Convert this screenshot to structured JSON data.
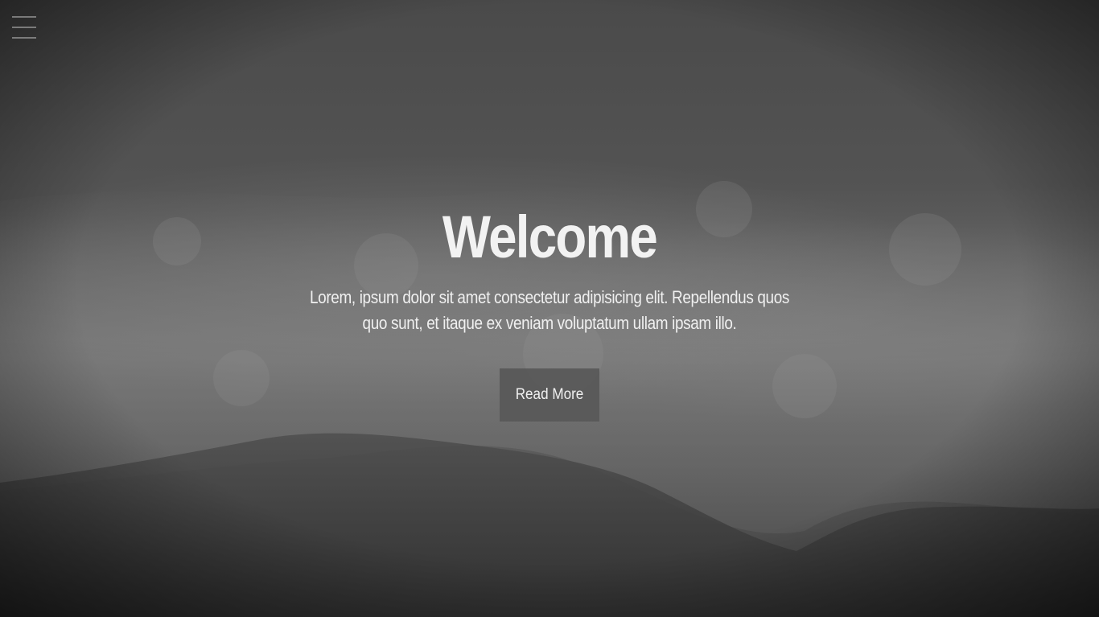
{
  "hero": {
    "title": "Welcome",
    "subtitle": "Lorem, ipsum dolor sit amet consectetur adipisicing elit. Repellendus quos quo sunt, et itaque ex veniam voluptatum ullam ipsam illo.",
    "button_label": "Read More",
    "background_image": "ocean-waves-aerial-grayscale"
  },
  "nav": {
    "menu_icon": "hamburger-menu-icon"
  },
  "colors": {
    "text": "#f2f2f2",
    "button_bg": "#585858",
    "menu_icon": "#969696"
  }
}
